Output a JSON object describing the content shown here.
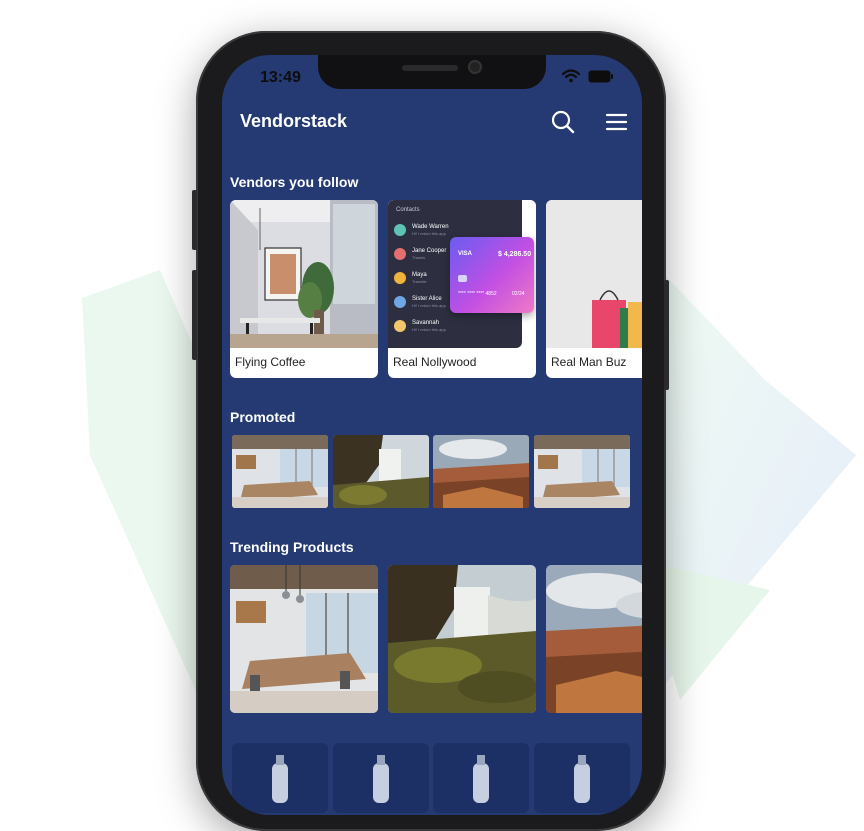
{
  "status_bar": {
    "time": "13:49",
    "icons": [
      "wifi-icon",
      "battery-icon"
    ]
  },
  "header": {
    "title": "Vendorstack",
    "icons": [
      "search-icon",
      "menu-icon"
    ]
  },
  "sections": {
    "vendors": {
      "title": "Vendors you follow",
      "items": [
        {
          "label": "Flying Coffee"
        },
        {
          "label": "Real Nollywood"
        },
        {
          "label": "Real Man Buz"
        }
      ]
    },
    "promoted": {
      "title": "Promoted"
    },
    "trending": {
      "title": "Trending Products"
    }
  },
  "contacts_mock": {
    "header": "Contacts",
    "people": [
      {
        "name": "Wade Warren",
        "sub": "Hi! I return this app"
      },
      {
        "name": "Jane Cooper",
        "sub": "Thanks"
      },
      {
        "name": "Maya",
        "sub": "Transfer"
      },
      {
        "name": "Sister Alice",
        "sub": "Hi! I return this app"
      },
      {
        "name": "Savannah",
        "sub": "Hi! I return this app"
      }
    ],
    "card": {
      "brand": "VISA",
      "amount": "$ 4,286.50",
      "number": "**** **** **** 4852",
      "expiry": "02/24"
    }
  },
  "colors": {
    "screen_bg": "#253a72",
    "card_bg": "#ffffff",
    "phone_body": "#1b1b1d"
  }
}
